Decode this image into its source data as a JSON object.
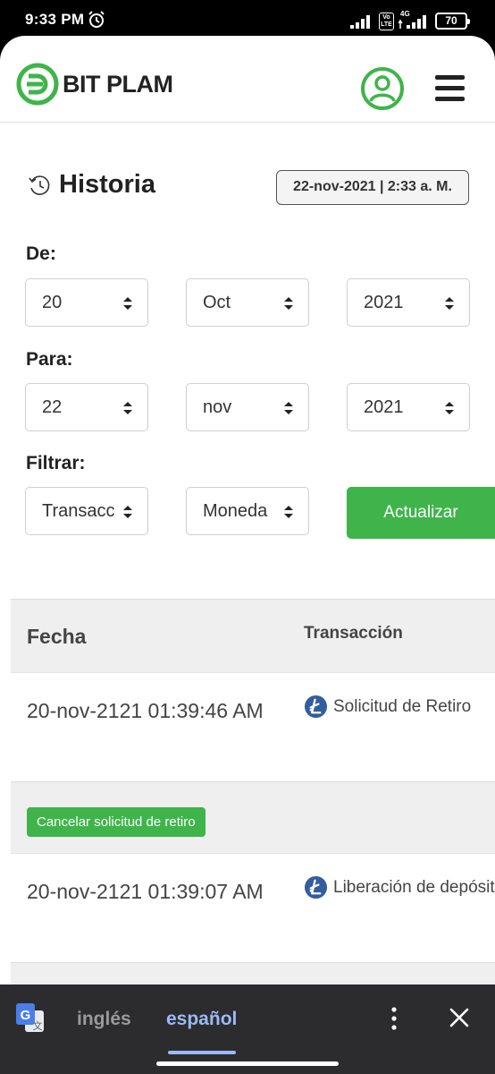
{
  "status_bar": {
    "time": "9:33 PM",
    "battery": "70",
    "network": "4G",
    "volte": "Vo LTE"
  },
  "header": {
    "brand": "BIT PLAM"
  },
  "page": {
    "title": "Historia",
    "datetime": "22-nov-2021 | 2:33 a. M."
  },
  "filters": {
    "from_label": "De:",
    "from": {
      "day": "20",
      "month": "Oct",
      "year": "2021"
    },
    "to_label": "Para:",
    "to": {
      "day": "22",
      "month": "nov",
      "year": "2021"
    },
    "filter_label": "Filtrar:",
    "transaction_type": "Transacción",
    "currency": "Moneda",
    "update_button": "Actualizar"
  },
  "table": {
    "headers": {
      "date": "Fecha",
      "transaction": "Transacción"
    },
    "rows": [
      {
        "date": "20-nov-2121 01:39:46 AM",
        "transaction": "Solicitud de Retiro",
        "action": "Cancelar solicitud de retiro"
      },
      {
        "date": "20-nov-2121 01:39:07 AM",
        "transaction": "Liberación de depósito"
      }
    ]
  },
  "translate_bar": {
    "source_lang": "inglés",
    "target_lang": "español"
  },
  "colors": {
    "brand_green": "#3fb44a",
    "litecoin_blue": "#345d9d",
    "accent_translate": "#9cb9f4"
  },
  "icons": [
    "alarm-icon",
    "signal-icon",
    "battery-icon",
    "logo-icon",
    "user-account-icon",
    "hamburger-menu-icon",
    "history-clock-icon",
    "select-arrows-icon",
    "litecoin-icon",
    "google-translate-icon",
    "more-vert-icon",
    "close-icon"
  ]
}
